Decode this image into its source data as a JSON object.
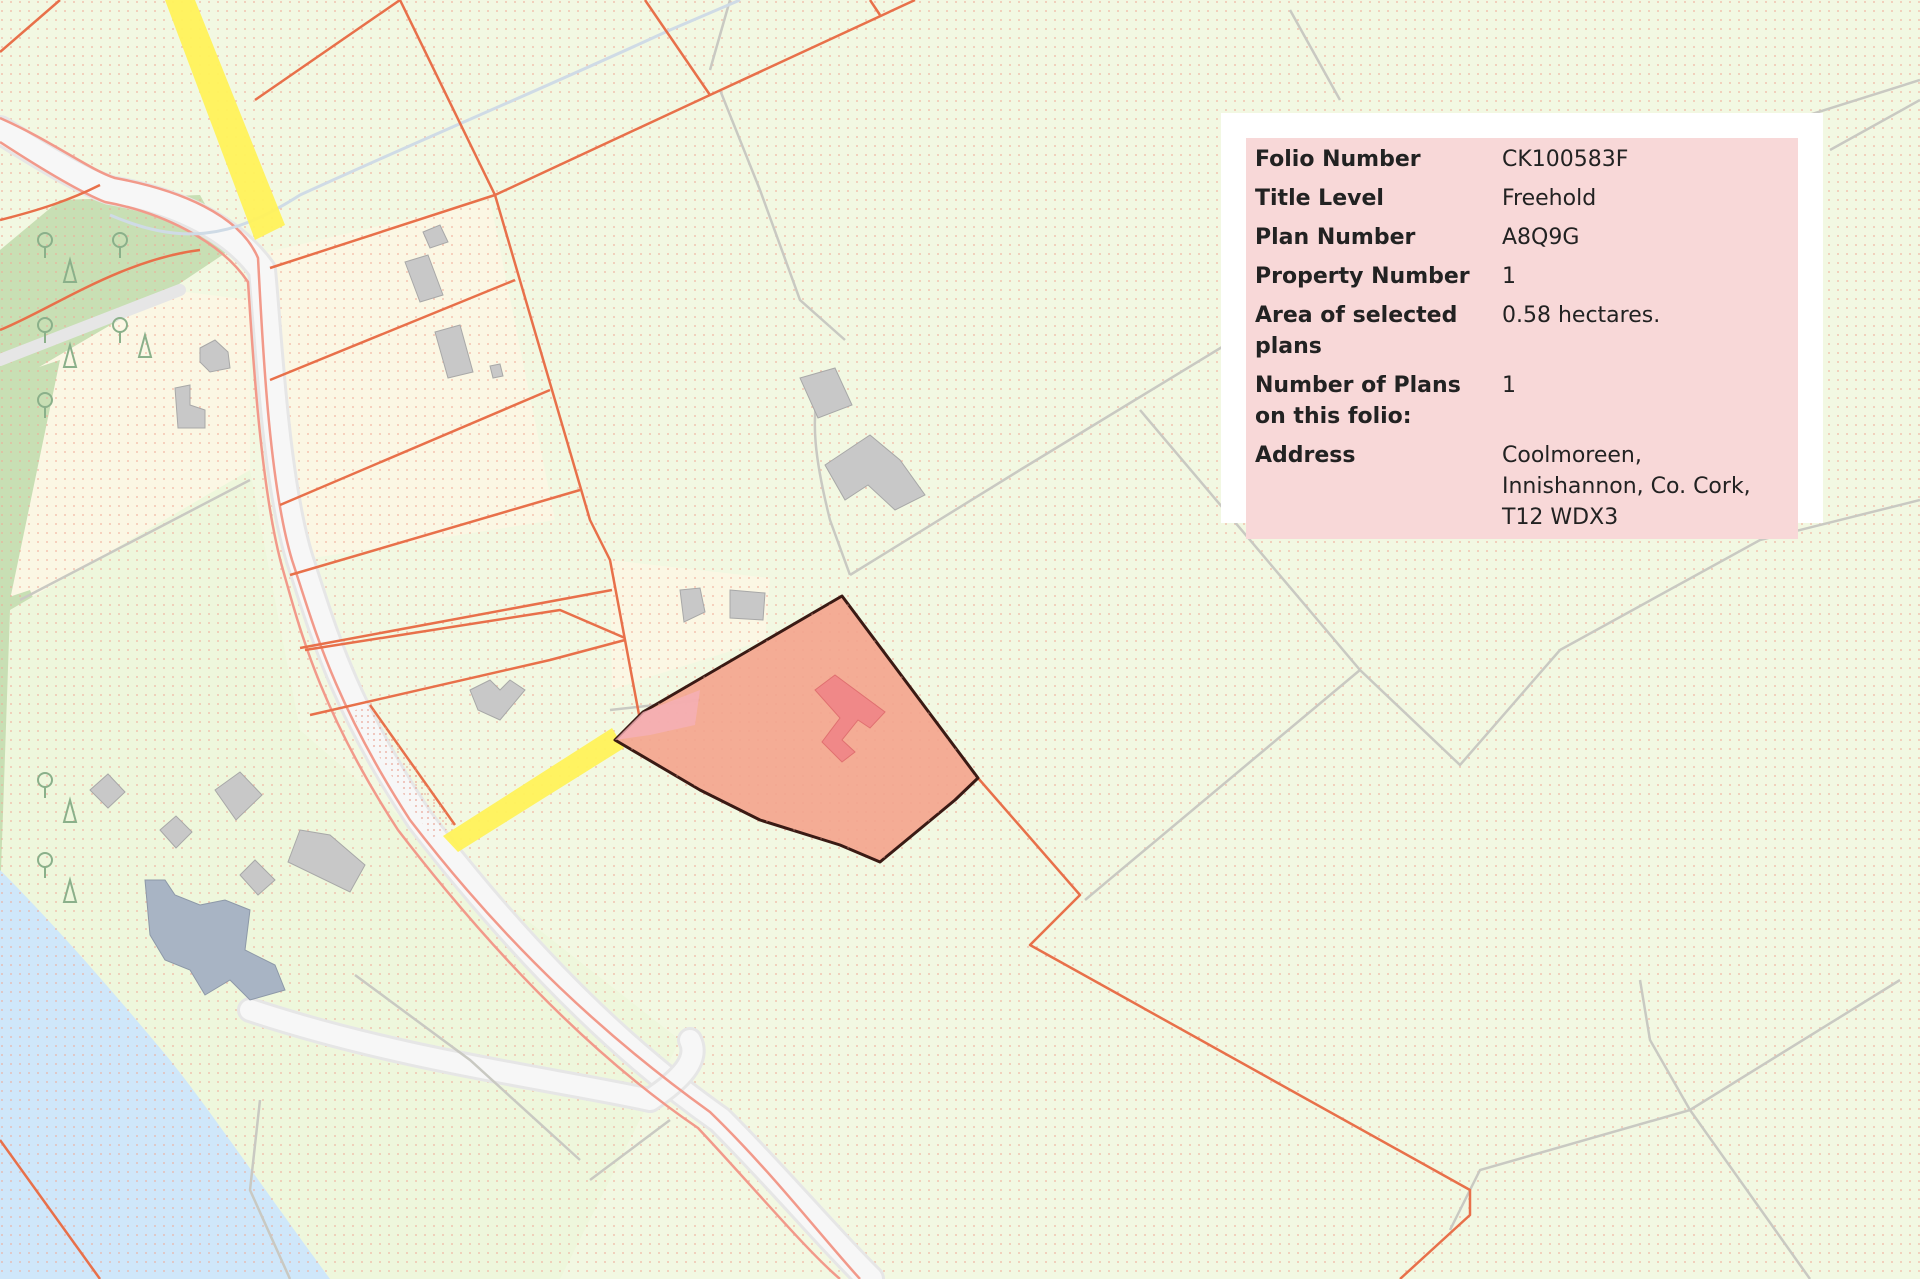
{
  "colors": {
    "background": "#f2f8e2",
    "parcel_line": "#e8704a",
    "selected_fill": "#f4a08a",
    "selected_outline": "#3a1a14",
    "right_of_way": "#fff25a",
    "road": "#f4f4f4",
    "water": "#cfe7fa",
    "woodland": "#c8dfb4",
    "building": "#c2c2c2",
    "panel_bg": "#f8d8d8"
  },
  "folio": {
    "rows": [
      {
        "label": "Folio Number",
        "value": "CK100583F"
      },
      {
        "label": "Title Level",
        "value": "Freehold"
      },
      {
        "label": "Plan Number",
        "value": "A8Q9G"
      },
      {
        "label": "Property Number",
        "value": "1"
      },
      {
        "label": "Area of selected plans",
        "value": "0.58 hectares."
      },
      {
        "label": "Number of Plans on this folio:",
        "value": "1"
      },
      {
        "label": "Address",
        "value": "Coolmoreen, Innishannon, Co. Cork, T12 WDX3"
      }
    ]
  }
}
